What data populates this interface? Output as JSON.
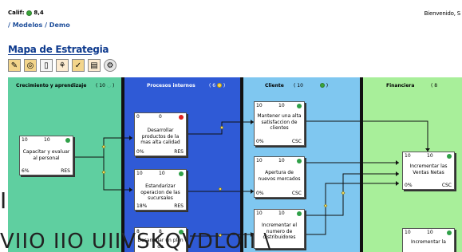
{
  "header": {
    "calif_label": "Calif:",
    "calif_value": "8,4",
    "welcome": "Bienvenido, S",
    "status_color": "#3aa63a"
  },
  "breadcrumb": "/ Modelos / Demo",
  "page_title": "Mapa de Estrategia",
  "toolbar": {
    "icons": [
      "new-objective-icon",
      "target-icon",
      "document-icon",
      "tree-icon",
      "initiative-icon",
      "pdf-icon",
      "settings-icon"
    ]
  },
  "columns": [
    {
      "title": "Crecimiento y aprendizaje",
      "count": "10",
      "color": "#5fcfa0"
    },
    {
      "title": "Procesos internos",
      "count": "6",
      "color": "#2f5ad6"
    },
    {
      "title": "Cliente",
      "count": "10",
      "color": "#7fc7f0"
    },
    {
      "title": "Financiera",
      "count": "8",
      "color": "#a8ef9a"
    }
  ],
  "nodes": {
    "capacitar": {
      "a": "10",
      "b": "10",
      "text": "Capacitar y evaluar al personal",
      "pct": "6%",
      "owner": "RES",
      "status": "#2fa048"
    },
    "desarrollar": {
      "a": "0",
      "b": "0",
      "text": "Desarrollar productos de la mas alta calidad",
      "pct": "0%",
      "owner": "RES",
      "status": "#e02020"
    },
    "estandarizar": {
      "a": "10",
      "b": "10",
      "text": "Estandarizar operacion de las sucursales",
      "pct": "18%",
      "owner": "RES",
      "status": "#2fa048"
    },
    "desarrollar_plan": {
      "a": "8",
      "b": "8",
      "text": "Desarrollar un plan de",
      "pct": "",
      "owner": "",
      "status": "#2fa048"
    },
    "mantener": {
      "a": "10",
      "b": "10",
      "text": "Mantener una alta satisfaccion de clientes",
      "pct": "0%",
      "owner": "CSC",
      "status": "#2fa048"
    },
    "apertura": {
      "a": "10",
      "b": "10",
      "text": "Apertura de nuevos mercados",
      "pct": "0%",
      "owner": "CSC",
      "status": "#2fa048"
    },
    "incrementar_dist": {
      "a": "10",
      "b": "10",
      "text": "Incrementar el numero de distribuidores",
      "pct": "",
      "owner": "",
      "status": "#2fa048"
    },
    "incrementar_ventas": {
      "a": "10",
      "b": "10",
      "text": "Incrementar las Ventas Netas",
      "pct": "0%",
      "owner": "CSC",
      "status": "#2fa048"
    },
    "incrementar_la": {
      "a": "10",
      "b": "10",
      "text": "Incrementar la",
      "pct": "",
      "owner": "",
      "status": "#2fa048"
    }
  },
  "overlay_text": {
    "line1": "I",
    "line2": "VIIO  IIO  UIIVSKQVDLOII  \\"
  }
}
